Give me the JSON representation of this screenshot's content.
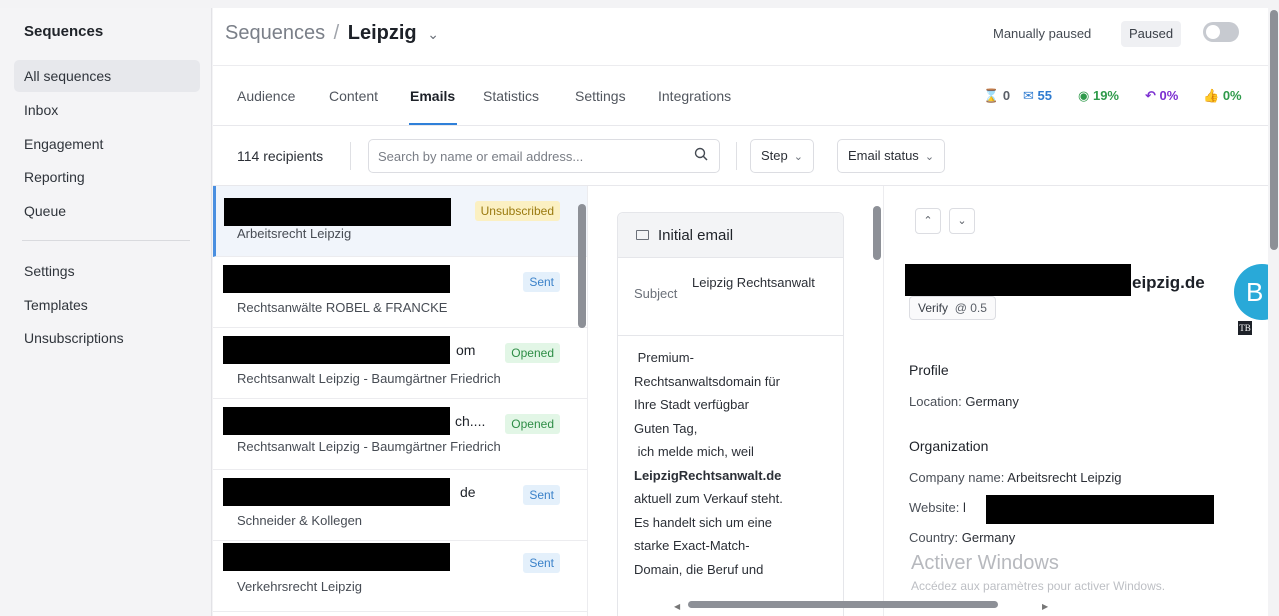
{
  "sidebar": {
    "title": "Sequences",
    "items": [
      {
        "label": "All sequences"
      },
      {
        "label": "Inbox"
      },
      {
        "label": "Engagement"
      },
      {
        "label": "Reporting"
      },
      {
        "label": "Queue"
      },
      {
        "label": "Settings"
      },
      {
        "label": "Templates"
      },
      {
        "label": "Unsubscriptions"
      }
    ]
  },
  "header": {
    "breadcrumb_root": "Sequences",
    "breadcrumb_sep": "/",
    "breadcrumb_current": "Leipzig",
    "manual_label": "Manually paused",
    "status_badge": "Paused"
  },
  "tabs": [
    {
      "label": "Audience"
    },
    {
      "label": "Content"
    },
    {
      "label": "Emails"
    },
    {
      "label": "Statistics"
    },
    {
      "label": "Settings"
    },
    {
      "label": "Integrations"
    }
  ],
  "stats": {
    "pending": "0",
    "sent": "55",
    "opened": "19%",
    "replied": "0%",
    "positive": "0%"
  },
  "filters": {
    "recipients": "114 recipients",
    "search_placeholder": "Search by name or email address...",
    "step_label": "Step",
    "email_status_label": "Email status"
  },
  "recipients": [
    {
      "name_tail": "",
      "org": "Arbeitsrecht Leipzig",
      "status": "Unsubscribed"
    },
    {
      "name_tail": "",
      "org": "Rechtsanwälte ROBEL & FRANCKE",
      "status": "Sent"
    },
    {
      "name_tail": "om",
      "org": "Rechtsanwalt Leipzig - Baumgärtner Friedrich",
      "status": "Opened"
    },
    {
      "name_tail": "ch....",
      "org": "Rechtsanwalt Leipzig - Baumgärtner Friedrich",
      "status": "Opened"
    },
    {
      "name_tail": "de",
      "org": "Schneider & Kollegen",
      "status": "Sent"
    },
    {
      "name_tail": "",
      "org": "Verkehrsrecht Leipzig",
      "status": "Sent"
    }
  ],
  "email": {
    "title": "Initial email",
    "subject_label": "Subject",
    "subject_value": "Leipzig Rechtsanwalt",
    "body_lines": [
      " Premium-",
      "Rechtsanwaltsdomain für",
      "Ihre Stadt verfügbar",
      "Guten Tag,",
      " ich melde mich, weil",
      "LeipzigRechtsanwalt.de",
      "aktuell zum Verkauf steht.",
      "Es handelt sich um eine",
      "starke Exact-Match-",
      "Domain, die Beruf und"
    ]
  },
  "contact": {
    "email_tail": "eipzig.de",
    "verify_label": "Verify",
    "score": "@ 0.5",
    "avatar_letter": "B",
    "avatar_tag": "TB",
    "profile_heading": "Profile",
    "location_label": "Location:",
    "location_value": "Germany",
    "org_heading": "Organization",
    "company_label": "Company name:",
    "company_value": "Arbeitsrecht Leipzig",
    "website_label": "Website:",
    "website_prefix": "l",
    "country_label": "Country:",
    "country_value": "Germany"
  },
  "watermark": {
    "line1": "Activer Windows",
    "line2": "Accédez aux paramètres pour activer Windows."
  },
  "colors": {
    "accent": "#2f80d9",
    "sent": "#3b82c9",
    "opened": "#2e8d46",
    "replied": "#7b2fd0",
    "unsubscribed": "#9a7a10"
  }
}
